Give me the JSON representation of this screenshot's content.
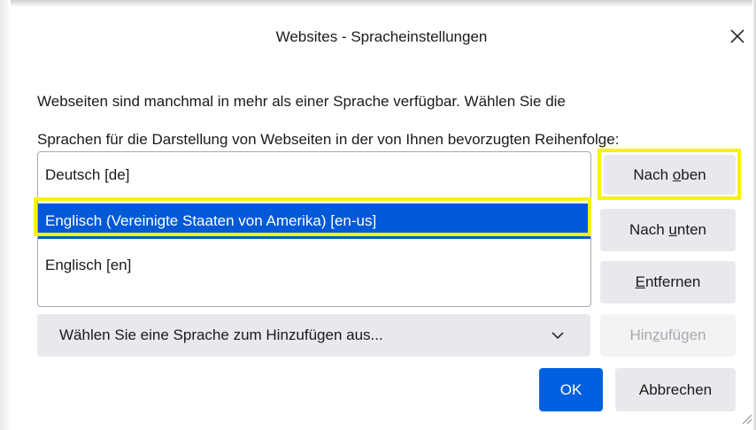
{
  "dialog": {
    "title": "Websites - Spracheinstellungen",
    "close_icon": "close-icon",
    "description_line1": "Webseiten sind manchmal in mehr als einer Sprache verfügbar. Wählen Sie die",
    "description_line2": "Sprachen für die Darstellung von Webseiten in der von Ihnen bevorzugten Reihenfolge:"
  },
  "languages": {
    "items": [
      {
        "label": "Deutsch [de]",
        "selected": false
      },
      {
        "label": "Englisch (Vereinigte Staaten von Amerika) [en-us]",
        "selected": true
      },
      {
        "label": "Englisch [en]",
        "selected": false
      }
    ]
  },
  "buttons": {
    "move_up": {
      "before": "Nach ",
      "underline": "o",
      "after": "ben"
    },
    "move_down": {
      "before": "Nach ",
      "underline": "u",
      "after": "nten"
    },
    "remove": {
      "before": "",
      "underline": "E",
      "after": "ntfernen"
    },
    "add": {
      "before": "Hin",
      "underline": "z",
      "after": "ufügen",
      "disabled": true
    },
    "ok": "OK",
    "cancel": "Abbrechen"
  },
  "language_select": {
    "selected_value": "Wählen Sie eine Sprache zum Hinzufügen aus...",
    "icon": "chevron-down-icon"
  },
  "colors": {
    "selection": "#0059d6",
    "primary_button": "#0061e0",
    "highlight": "#f7f20e",
    "button_bg": "#e9e9ed"
  }
}
